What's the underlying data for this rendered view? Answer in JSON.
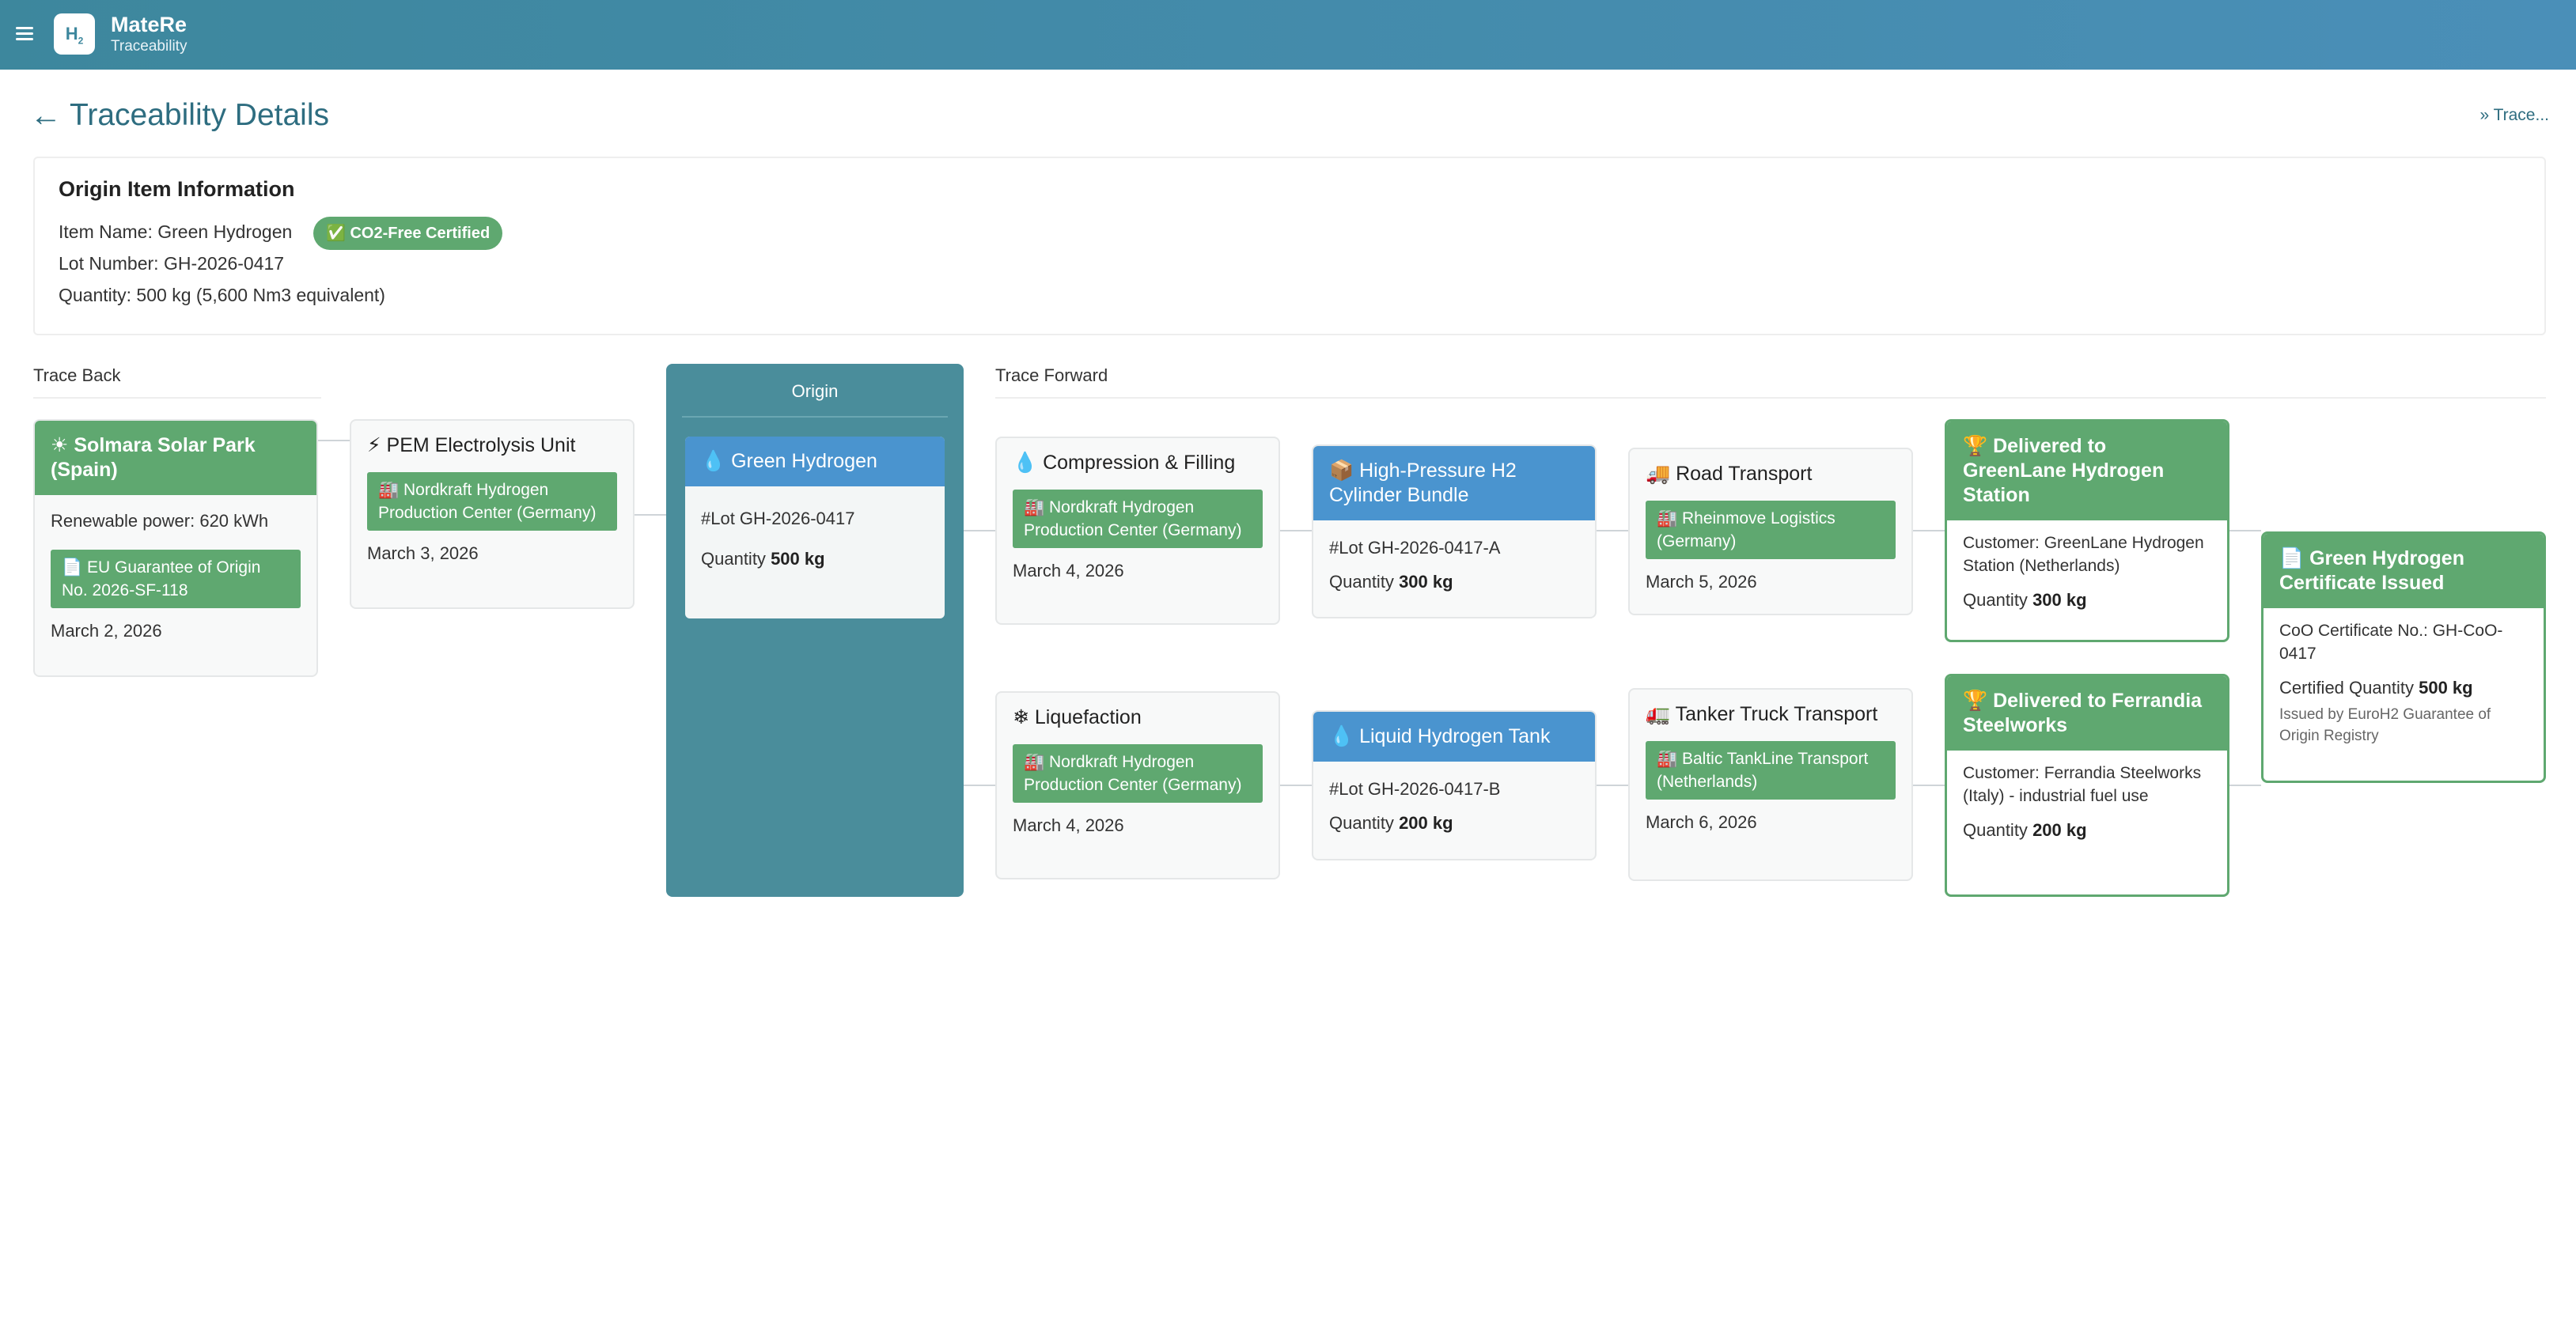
{
  "app": {
    "name": "MateRe",
    "subtitle": "Traceability",
    "logo_text": "H",
    "logo_sub": "2"
  },
  "header": {
    "back_icon": "←",
    "title": "Traceability Details",
    "breadcrumb": "» Trace..."
  },
  "origin_info": {
    "heading": "Origin Item Information",
    "item_name": "Item Name: Green Hydrogen",
    "badge": "✅ CO2-Free Certified",
    "lot_number": "Lot Number: GH-2026-0417",
    "quantity": "Quantity: 500 kg (5,600 Nm3 equivalent)"
  },
  "sections": {
    "trace_back": "Trace Back",
    "origin": "Origin",
    "trace_forward": "Trace Forward"
  },
  "trace_back": [
    {
      "icon": "☀",
      "title": "Solmara Solar Park (Spain)",
      "detail": "Renewable power: 620 kWh",
      "location": "📄 EU Guarantee of Origin No. 2026-SF-118",
      "date": "March 2, 2026"
    },
    {
      "icon": "⚡",
      "title": "PEM Electrolysis Unit",
      "location": "🏭 Nordkraft Hydrogen Production Center (Germany)",
      "date": "March 3, 2026"
    }
  ],
  "origin": {
    "icon": "💧",
    "title": "Green Hydrogen",
    "lot": "#Lot GH-2026-0417",
    "qty_label": "Quantity",
    "qty_value": "500 kg"
  },
  "forward_process": [
    {
      "icon": "💧",
      "title": "Compression & Filling",
      "location": "🏭 Nordkraft Hydrogen Production Center (Germany)",
      "date": "March 4, 2026"
    },
    {
      "icon": "❄",
      "title": "Liquefaction",
      "location": "🏭 Nordkraft Hydrogen Production Center (Germany)",
      "date": "March 4, 2026"
    }
  ],
  "forward_lots": [
    {
      "icon": "📦",
      "title": "High-Pressure H2 Cylinder Bundle",
      "lot": "#Lot GH-2026-0417-A",
      "qty_label": "Quantity",
      "qty_value": "300 kg"
    },
    {
      "icon": "💧",
      "title": "Liquid Hydrogen Tank",
      "lot": "#Lot GH-2026-0417-B",
      "qty_label": "Quantity",
      "qty_value": "200 kg"
    }
  ],
  "forward_transport": [
    {
      "icon": "🚚",
      "title": "Road Transport",
      "location": "🏭 Rheinmove Logistics (Germany)",
      "date": "March 5, 2026"
    },
    {
      "icon": "🚛",
      "title": "Tanker Truck Transport",
      "location": "🏭 Baltic TankLine Transport (Netherlands)",
      "date": "March 6, 2026"
    }
  ],
  "deliveries": [
    {
      "icon": "🏆",
      "title": "Delivered to GreenLane Hydrogen Station",
      "customer": "Customer: GreenLane Hydrogen Station (Netherlands)",
      "qty_label": "Quantity",
      "qty_value": "300 kg"
    },
    {
      "icon": "🏆",
      "title": "Delivered to Ferrandia Steelworks",
      "customer": "Customer: Ferrandia Steelworks (Italy) - industrial fuel use",
      "qty_label": "Quantity",
      "qty_value": "200 kg"
    }
  ],
  "certificate": {
    "icon": "📄",
    "title": "Green Hydrogen Certificate Issued",
    "number": "CoO Certificate No.: GH-CoO-0417",
    "qty_label": "Certified Quantity",
    "qty_value": "500 kg",
    "issuer": "Issued by EuroH2 Guarantee of Origin Registry"
  },
  "colors": {
    "topbar_start": "#3d879d",
    "topbar_end": "#4a8fb8",
    "green": "#5fa870",
    "blue": "#4a94cf",
    "origin_column": "#4a8d9b",
    "title_teal": "#2e6d80"
  }
}
